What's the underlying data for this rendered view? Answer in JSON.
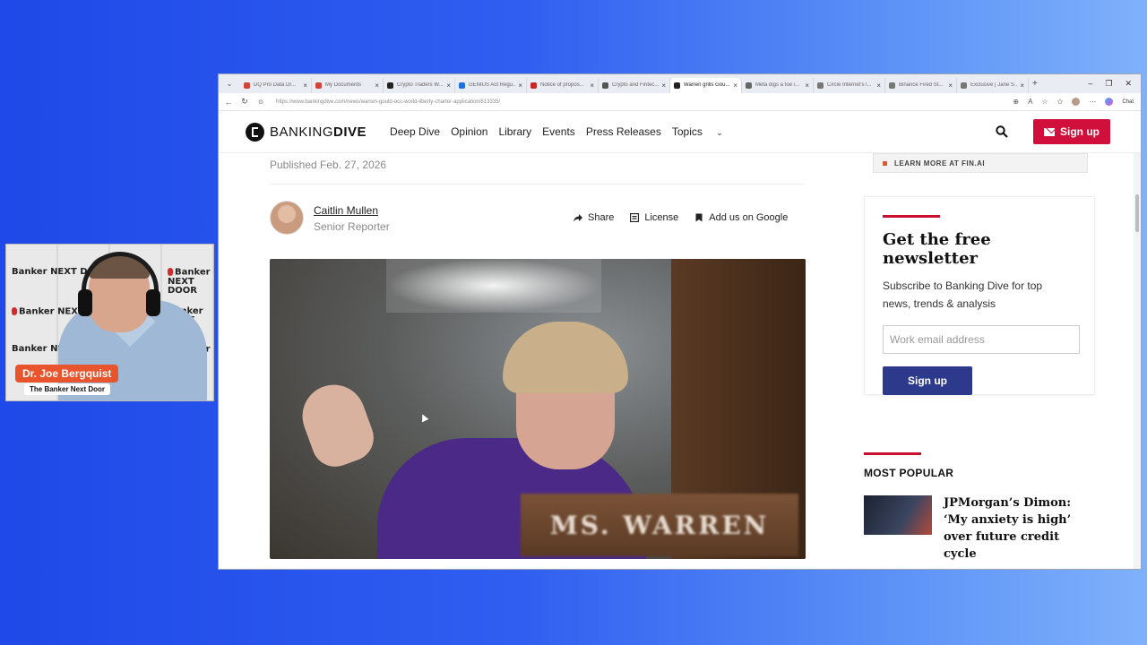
{
  "cam": {
    "name": "Dr. Joe Bergquist",
    "subtitle": "The Banker Next Door",
    "backdrop_logo": "Banker NEXT DOOR"
  },
  "browser": {
    "tabs": [
      {
        "label": "DQ Pro Data Dr...",
        "icon_color": "#d0443a",
        "active": false
      },
      {
        "label": "My Documents",
        "icon_color": "#d0443a",
        "active": false
      },
      {
        "label": "Crypto Traders W...",
        "icon_color": "#222222",
        "active": false
      },
      {
        "label": "GENIUS Act Regu...",
        "icon_color": "#1f6fe0",
        "active": false
      },
      {
        "label": "Notice of propos...",
        "icon_color": "#c62828",
        "active": false
      },
      {
        "label": "Crypto and Fintec...",
        "icon_color": "#555555",
        "active": false
      },
      {
        "label": "Warren grills Gou...",
        "icon_color": "#222222",
        "active": true
      },
      {
        "label": "Meta digs a toe i...",
        "icon_color": "#666666",
        "active": false
      },
      {
        "label": "Circle Internet's l...",
        "icon_color": "#777777",
        "active": false
      },
      {
        "label": "Binance Fired St...",
        "icon_color": "#777777",
        "active": false
      },
      {
        "label": "Exclusive | Jane S...",
        "icon_color": "#777777",
        "active": false
      }
    ],
    "url": "https://www.bankingdive.com/news/warren-gould-occ-world-liberty-charter-application/813335/",
    "chat_label": "Chat"
  },
  "site": {
    "brand_light": "BANKING",
    "brand_bold": "DIVE",
    "nav": [
      "Deep Dive",
      "Opinion",
      "Library",
      "Events",
      "Press Releases",
      "Topics"
    ],
    "signup_label": "Sign up",
    "promo": "LEARN MORE AT FIN.AI"
  },
  "article": {
    "published": "Published Feb. 27, 2026",
    "author_name": "Caitlin Mullen",
    "author_role": "Senior Reporter",
    "actions": [
      "Share",
      "License",
      "Add us on Google"
    ],
    "placard_text": "MS. WARREN"
  },
  "newsletter": {
    "title": "Get the free newsletter",
    "description": "Subscribe to Banking Dive for top news, trends & analysis",
    "input_placeholder": "Work email address",
    "button_label": "Sign up"
  },
  "most_popular": {
    "title": "MOST POPULAR",
    "headline": "JPMorgan’s Dimon: ‘My anxiety is high’ over future credit cycle"
  }
}
